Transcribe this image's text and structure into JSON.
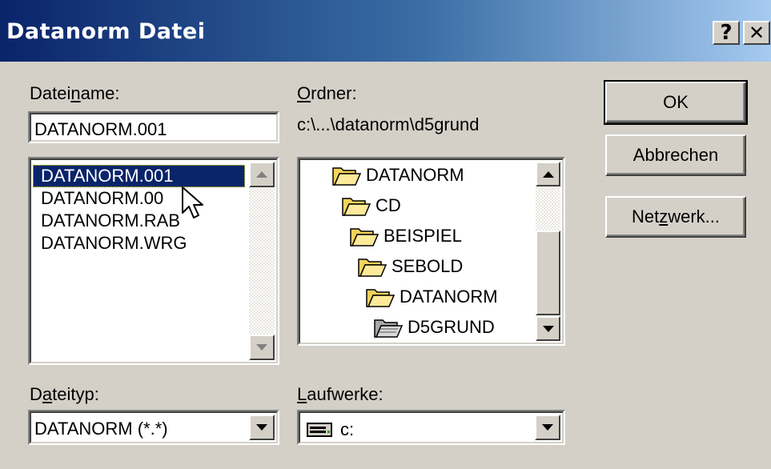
{
  "window": {
    "title": "Datanorm Datei",
    "help_glyph": "?",
    "close_glyph": "✕"
  },
  "filename": {
    "label_pre": "Datei",
    "label_u": "n",
    "label_post": "ame:",
    "value": "DATANORM.001",
    "files": [
      "DATANORM.001",
      "DATANORM.00",
      "DATANORM.RAB",
      "DATANORM.WRG"
    ],
    "selected_index": 0
  },
  "folder": {
    "label_u": "O",
    "label_post": "rdner:",
    "path": "c:\\...\\datanorm\\d5grund",
    "tree": [
      "DATANORM",
      "CD",
      "BEISPIEL",
      "SEBOLD",
      "DATANORM",
      "D5GRUND"
    ],
    "current_index": 5
  },
  "buttons": {
    "ok": "OK",
    "cancel": "Abbrechen",
    "network_pre": "Net",
    "network_u": "z",
    "network_post": "werk..."
  },
  "filetype": {
    "label_pre": "D",
    "label_u": "a",
    "label_post": "teityp:",
    "value": "DATANORM (*.*)"
  },
  "drives": {
    "label_u": "L",
    "label_post": "aufwerke:",
    "value": "c:",
    "icon": "drive-icon"
  },
  "colors": {
    "selection": "#0a246a",
    "face": "#d4d0c8",
    "folder": "#f5d25a"
  }
}
